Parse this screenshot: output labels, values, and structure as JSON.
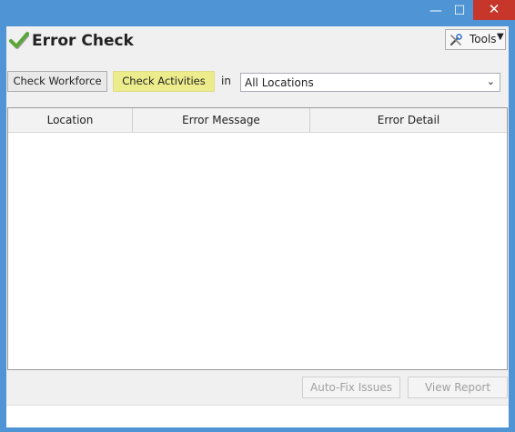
{
  "window": {
    "minimize_glyph": "—",
    "maximize_glyph": "☐",
    "close_glyph": "✕"
  },
  "header": {
    "title": "Error Check",
    "app_icon": "checkmark-icon",
    "tools_label": "Tools",
    "tools_icon": "tools-icon"
  },
  "toolbar": {
    "check_workforce_label": "Check Workforce",
    "check_activities_label": "Check Activities",
    "in_label": "in",
    "location_select_value": "All Locations"
  },
  "grid": {
    "columns": [
      "Location",
      "Error Message",
      "Error Detail"
    ],
    "rows": []
  },
  "footer": {
    "autofix_label": "Auto-Fix Issues",
    "view_report_label": "View Report"
  },
  "colors": {
    "titlebar": "#4f94d4",
    "close_button": "#c7362b",
    "highlight_button": "#ecec8c",
    "check_green": "#5aa63a"
  }
}
